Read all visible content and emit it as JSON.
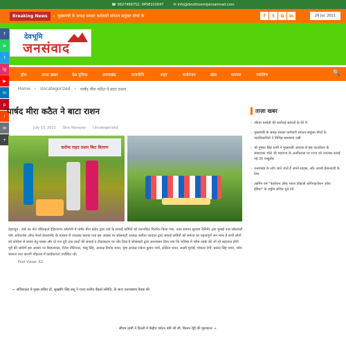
{
  "topbar": {
    "phone": "9627466752, 9458102647",
    "email": "info@devbhoomijansamvad.com"
  },
  "news": {
    "badge": "Breaking News",
    "text": "मुख्यमंत्री के समक्ष समस्त कर्मचारी संगठन सयुंक्त मोर्चा के",
    "date": "26 Jul, 2021",
    "social": [
      "f",
      "t",
      "G",
      "in"
    ]
  },
  "logo": {
    "line1": "देवभूमि",
    "line2": "जनसंवाद"
  },
  "nav": {
    "items": [
      "होम",
      "ताजा खबर",
      "देश दुनिया",
      "उत्तराखंड",
      "राजनीति",
      "शहर",
      "मनोरंजन",
      "खेल",
      "व्यापार",
      "ज्योतिष"
    ],
    "search": "🔍"
  },
  "breadcrumb": {
    "home": "Home",
    "cat": "Uncategorized",
    "current": "पार्षद मीरा कठैत ने बाटा राशन"
  },
  "post": {
    "title": "पार्षद मीरा कठैत ने बाटा राशन",
    "date": "July 13, 2021",
    "author": "Shiv Narayan",
    "category": "Uncategorized",
    "banner": "करोना राहत राशन किट वितरण",
    "body": "देहरादून , वार्ड नंo 40 चंदिगढ़ता इंदिरानगर कॉलोनी में पार्षद मीरा कठैत द्वारा वार्ड के सफाई कर्मियों को राशनकिट वितरित किया गया, उक्त सामान सुरज्ञ्या वेलिमेंट ट्रस्ट मुम्बई तथा सोसायटी फोर अवेयरनेस ऑफ नेवर्स डेवलपमेंट के माध्यम से उपलब्ध कराया गया इस अवसर पर सोसायटी अध्यक्ष अनीता पटवाल द्वारा सफाई कर्मियों को समाज का महत्वपूर्ण अंग माना है सभी लोगों को कोरोना से बचाव हेतु मास्क और दो गज दूरी तथा हाथों की सफाई व टीकाकरण पर जोर दिया है सोसायटी द्वारा आश्वासन दिया गया कि भविष्य में गरीब तबके की जो भी सहायता होगी पूरी की जायेगी इस अवसर पर बिजलवाल, रीतेश नौटियाल, गब्बू सिंह, अध्यक्ष विनोद रावत, कृष अध्यक्ष राकेश कुमार शर्मा, ललिता रावत, लक्ष्मी गुसाई, चंचाला नेगी, प्रसाद सिंह पवार, रमेश काशल तथा कारगी मोहल्ला में कार्यकारता उपस्थित रहे।",
    "views": "Post Views:  62"
  },
  "nav_posts": {
    "prev": "← सचिवालय में मुख्य सचिव डॉ. सुखबीर सिंह संधु ने राज्य स्तरीय बैंकर्स समिति, के साथ उत्तराखण्ड बैठक की",
    "next": "सीएम धामी ने दिल्ली में केंद्रीय पर्यटन मंत्री श्री जी. किशन रेड्डी की मुलाकात →"
  },
  "sidebar": {
    "heading": "ताज़ा खबर",
    "items": [
      "जीएम चमोली की कार्रवाई सवालों के घेरे में",
      "मुख्यमंत्री के समक्ष समस्त कर्मचारी संगठन सयुंक्त मोर्चा के पदाधिकारियों ने विभिन्न समस्याएं रखी",
      "श्री पुष्कर सिंह धामी ने मुख्यमंत्री आवास से हंस फाउंडेशन के संस्थापक भोले जी महाराज के अनपिलास पर राज्य को उपलब्ध कराई गई 30 एम्बुलेंस",
      "उत्तराखंड के लोग जाने जाते हैं अपने साहस, और अपनी ईमानदारी के लिए",
      "आर्मिन वर्म \"फेडरेशन ऑफ भारत डॉक्टर्स ऑर्गनाइजेशन ऑफ इंडिया\" के राष्ट्रीय सचिव चुने गये"
    ]
  },
  "colors": {
    "orange": "#ff6f00",
    "green": "#54d20a",
    "dark_green": "#2e7d32",
    "red": "#c62828"
  }
}
